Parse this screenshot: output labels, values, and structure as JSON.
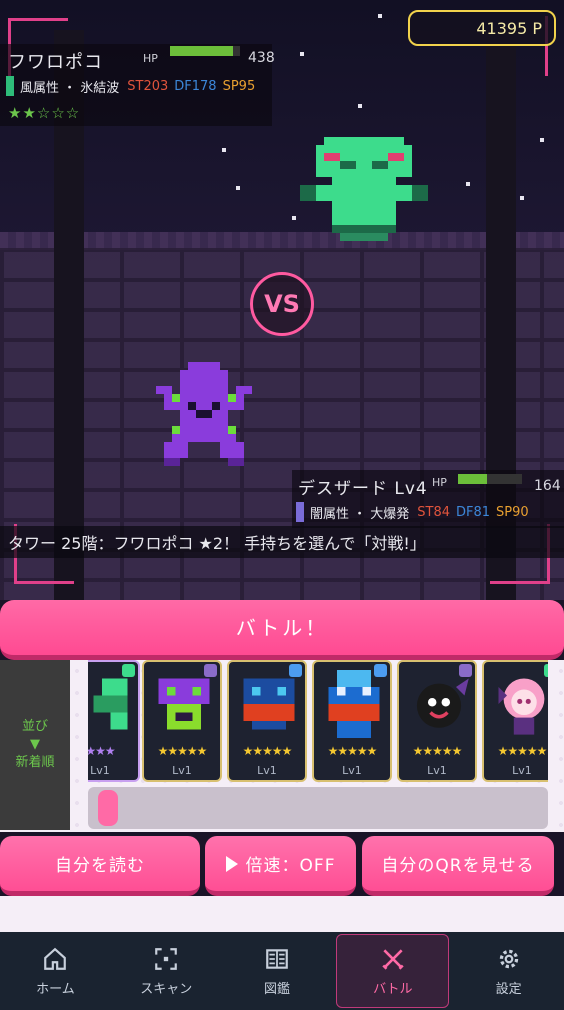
{
  "points": "41395 P",
  "enemy": {
    "name": "フワロポコ",
    "hp_label": "HP",
    "hp_value": "438",
    "hp_ratio": 0.9,
    "attribute": "風属性 ・ 氷結波",
    "st": "ST203",
    "df": "DF178",
    "sp": "SP95",
    "stars": "★★☆☆☆",
    "color": "#3ddc8c"
  },
  "vs": "VS",
  "ally": {
    "name": "デスザード Lv4",
    "hp_label": "HP",
    "hp_value": "164",
    "hp_ratio": 0.45,
    "attribute": "闇属性 ・ 大爆発",
    "st": "ST84",
    "df": "DF81",
    "sp": "SP90",
    "color": "#8a3cdc"
  },
  "message": "タワー 25階：フワロポコ ★2！ 手持ちを選んで「対戦!」",
  "battle_button": "バトル！",
  "sort": {
    "line1": "並び",
    "arrow": "▼",
    "line2": "新着順"
  },
  "cards": [
    {
      "rarity": "★★★",
      "level": "Lv1",
      "badge": "#3ddc8c"
    },
    {
      "rarity": "★★★★★",
      "level": "Lv1",
      "badge": "#8a6cc8"
    },
    {
      "rarity": "★★★★★",
      "level": "Lv1",
      "badge": "#4c9cf0"
    },
    {
      "rarity": "★★★★★",
      "level": "Lv1",
      "badge": "#4c9cf0"
    },
    {
      "rarity": "★★★★★",
      "level": "Lv1",
      "badge": "#8a6cc8"
    },
    {
      "rarity": "★★★★★",
      "level": "Lv1",
      "badge": "#3ddc8c"
    }
  ],
  "actions": {
    "read_self": "自分を読む",
    "speed": "倍速：OFF",
    "show_qr": "自分のQRを見せる"
  },
  "tabs": [
    {
      "label": "ホーム",
      "icon": "home-icon"
    },
    {
      "label": "スキャン",
      "icon": "scan-icon"
    },
    {
      "label": "図鑑",
      "icon": "book-icon"
    },
    {
      "label": "バトル",
      "icon": "battle-icon"
    },
    {
      "label": "設定",
      "icon": "gear-icon"
    }
  ]
}
